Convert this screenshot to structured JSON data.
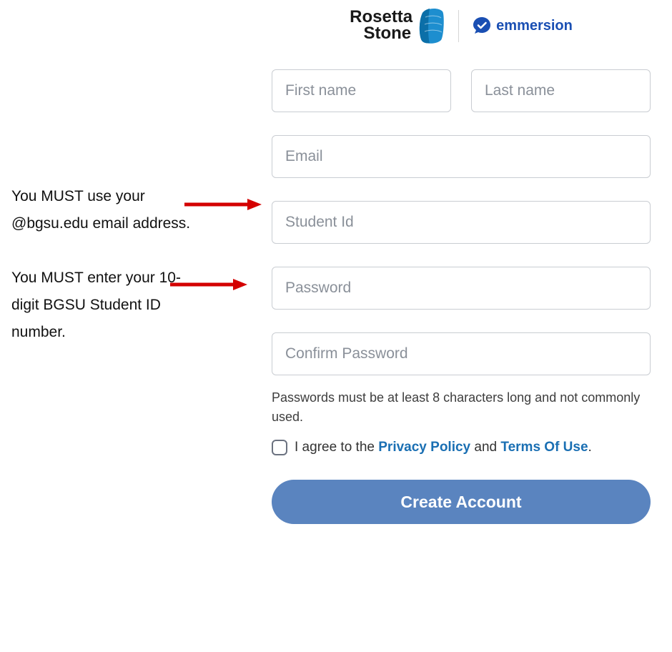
{
  "logos": {
    "rosetta_line1": "Rosetta",
    "rosetta_line2": "Stone",
    "emmersion": "emmersion"
  },
  "form": {
    "first_name_placeholder": "First name",
    "last_name_placeholder": "Last name",
    "email_placeholder": "Email",
    "student_id_placeholder": "Student Id",
    "password_placeholder": "Password",
    "confirm_password_placeholder": "Confirm Password",
    "password_helper": "Passwords must be at least 8 characters long and not commonly used.",
    "agree_prefix": "I agree to the ",
    "privacy_link": "Privacy Policy",
    "agree_middle": " and ",
    "terms_link": "Terms Of Use",
    "agree_suffix": ".",
    "create_button": "Create Account"
  },
  "annotations": {
    "email_note": "You MUST use your @bgsu.edu  email address.",
    "student_id_note": "You MUST enter your 10-digit BGSU Student ID number."
  },
  "colors": {
    "arrow": "#d40000",
    "link": "#1a6fb3",
    "button": "#5a84bf",
    "rs_icon": "#1d8ecf",
    "em_icon": "#1a4fb3"
  }
}
